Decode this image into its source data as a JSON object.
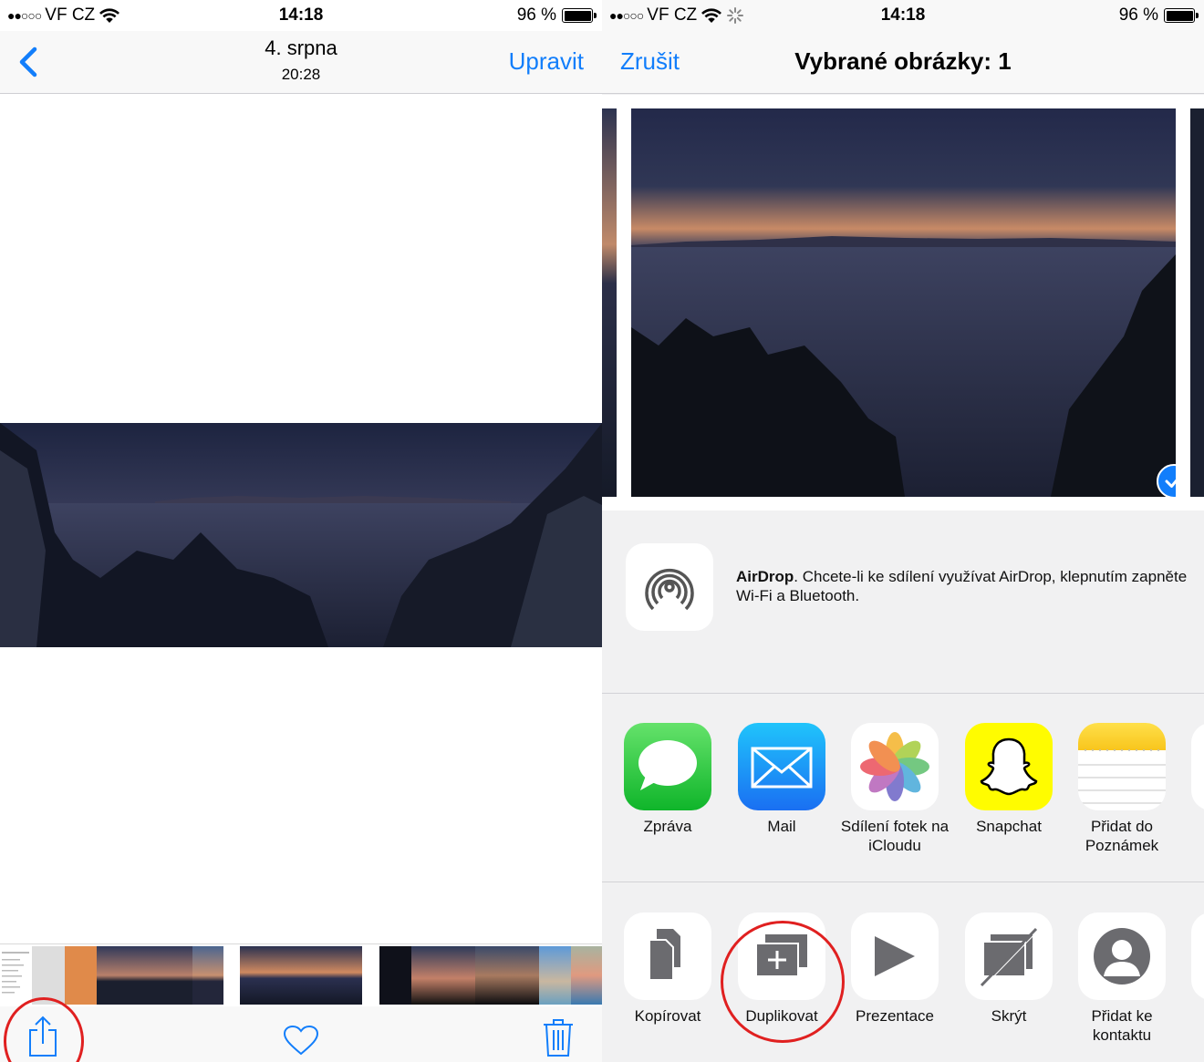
{
  "left": {
    "status": {
      "signal": "●●○○○",
      "carrier": "VF CZ",
      "time": "14:18",
      "battery": "96 %"
    },
    "nav": {
      "title": "4. srpna",
      "subtitle": "20:28",
      "edit_label": "Upravit"
    },
    "icons": {
      "back": "chevron-left-icon",
      "share": "share-icon",
      "favorite": "heart-icon",
      "delete": "trash-icon"
    }
  },
  "right": {
    "status": {
      "signal": "●●○○○",
      "carrier": "VF CZ",
      "time": "14:18",
      "battery": "96 %"
    },
    "nav": {
      "cancel_label": "Zrušit",
      "title": "Vybrané obrázky: 1"
    },
    "airdrop": {
      "name": "AirDrop",
      "message": ". Chcete-li ke sdílení využívat AirDrop, klepnutím zapněte Wi-Fi a Bluetooth."
    },
    "apps": [
      {
        "label": "Zpráva",
        "icon": "messages-icon"
      },
      {
        "label": "Mail",
        "icon": "mail-icon"
      },
      {
        "label": "Sdílení fotek na iCloudu",
        "icon": "photos-icon"
      },
      {
        "label": "Snapchat",
        "icon": "snapchat-icon"
      },
      {
        "label": "Přidat do Poznámek",
        "icon": "notes-icon"
      },
      {
        "label": "M",
        "icon": "partial-icon"
      }
    ],
    "actions": [
      {
        "label": "Kopírovat",
        "icon": "copy-icon"
      },
      {
        "label": "Duplikovat",
        "icon": "duplicate-icon"
      },
      {
        "label": "Prezentace",
        "icon": "play-icon"
      },
      {
        "label": "Skrýt",
        "icon": "hide-icon"
      },
      {
        "label": "Přidat ke kontaktu",
        "icon": "contact-icon"
      },
      {
        "label": "P",
        "icon": "partial-icon"
      }
    ]
  },
  "colors": {
    "accent": "#127efb",
    "annotation": "#e02020"
  }
}
